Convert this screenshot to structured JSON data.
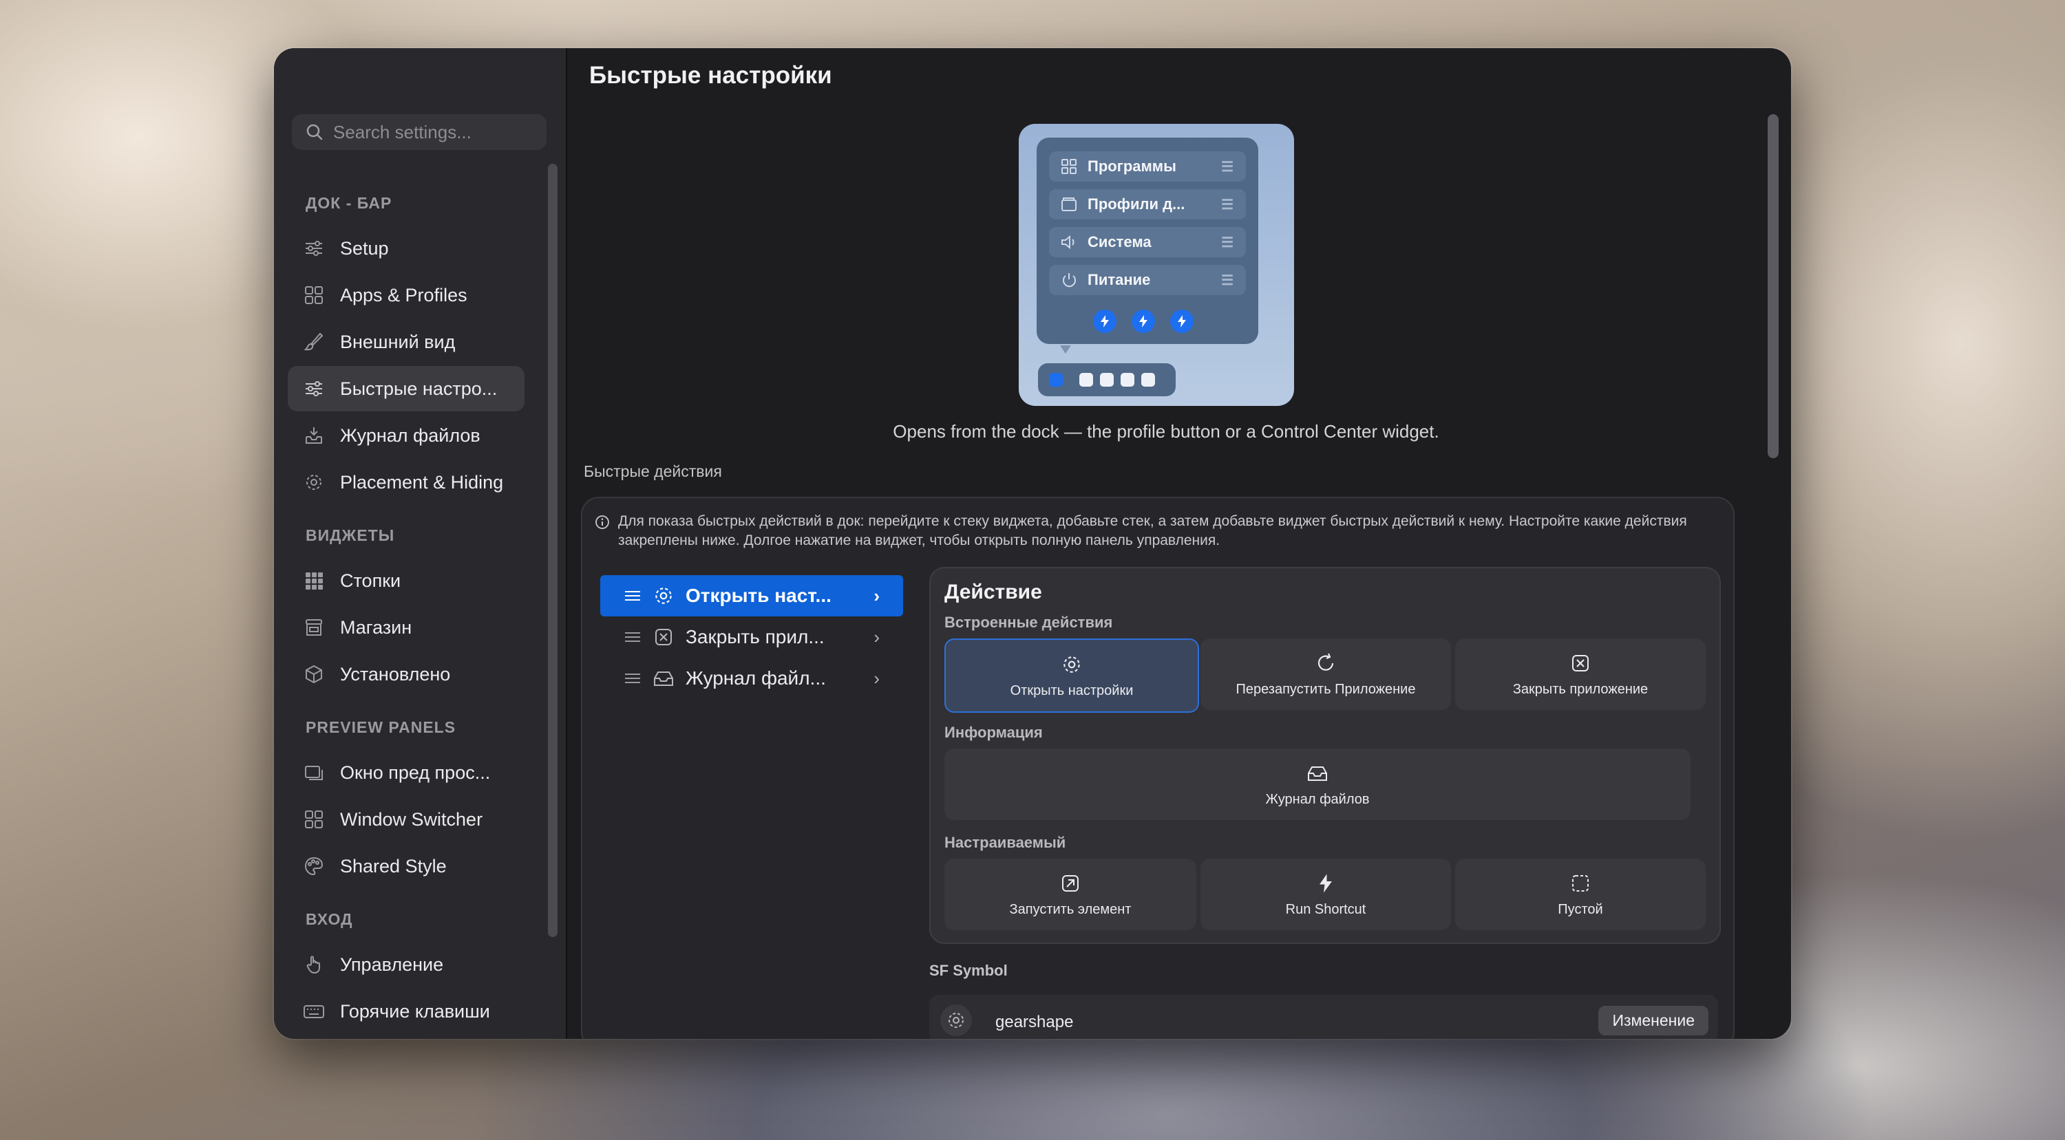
{
  "window": {
    "title": "Быстрые настройки"
  },
  "search": {
    "placeholder": "Search settings..."
  },
  "sidebar": {
    "sections": [
      {
        "title": "ДОК - БАР",
        "items": [
          {
            "label": "Setup",
            "icon": "sliders-icon"
          },
          {
            "label": "Apps & Profiles",
            "icon": "grid-icon"
          },
          {
            "label": "Внешний вид",
            "icon": "paintbrush-icon"
          },
          {
            "label": "Быстрые настро...",
            "icon": "sliders-icon",
            "active": true
          },
          {
            "label": "Журнал файлов",
            "icon": "tray-download-icon"
          },
          {
            "label": "Placement & Hiding",
            "icon": "gear-icon"
          }
        ]
      },
      {
        "title": "ВИДЖЕТЫ",
        "items": [
          {
            "label": "Стопки",
            "icon": "grid-filled-icon"
          },
          {
            "label": "Магазин",
            "icon": "storefront-icon"
          },
          {
            "label": "Установлено",
            "icon": "cube-icon"
          }
        ]
      },
      {
        "title": "PREVIEW PANELS",
        "items": [
          {
            "label": "Окно пред прос...",
            "icon": "windows-icon"
          },
          {
            "label": "Window Switcher",
            "icon": "grid-icon"
          },
          {
            "label": "Shared Style",
            "icon": "palette-icon"
          }
        ]
      },
      {
        "title": "ВХОД",
        "items": [
          {
            "label": "Управление",
            "icon": "hand-pointer-icon"
          },
          {
            "label": "Горячие клавиши",
            "icon": "keyboard-icon"
          }
        ]
      }
    ]
  },
  "preview": {
    "rows": [
      {
        "label": "Программы",
        "icon": "grid-icon"
      },
      {
        "label": "Профили д...",
        "icon": "folder-icon"
      },
      {
        "label": "Система",
        "icon": "speaker-icon"
      },
      {
        "label": "Питание",
        "icon": "power-icon"
      }
    ],
    "caption": "Opens from the dock — the profile button or a Control Center widget."
  },
  "quick_actions": {
    "section_label": "Быстрые действия",
    "info": "Для показа быстрых действий в док: перейдите к стеку виджета, добавьте стек, а затем добавьте виджет быстрых действий к нему. Настройте какие действия закреплены ниже. Долгое нажатие на виджет, чтобы открыть полную панель управления.",
    "list": [
      {
        "label": "Открыть наст...",
        "icon": "gear-icon",
        "selected": true
      },
      {
        "label": "Закрыть прил...",
        "icon": "xmark-square-icon"
      },
      {
        "label": "Журнал файл...",
        "icon": "tray-icon"
      }
    ]
  },
  "action": {
    "title": "Действие",
    "groups": [
      {
        "title": "Встроенные действия",
        "buttons": [
          {
            "label": "Открыть настройки",
            "icon": "gear-icon",
            "selected": true
          },
          {
            "label": "Перезапустить Приложение",
            "icon": "restart-icon"
          },
          {
            "label": "Закрыть приложение",
            "icon": "xmark-square-icon"
          }
        ]
      },
      {
        "title": "Информация",
        "buttons": [
          {
            "label": "Журнал файлов",
            "icon": "tray-icon"
          }
        ]
      },
      {
        "title": "Настраиваемый",
        "buttons": [
          {
            "label": "Запустить элемент",
            "icon": "arrow-up-right-square-icon"
          },
          {
            "label": "Run Shortcut",
            "icon": "bolt-icon"
          },
          {
            "label": "Пустой",
            "icon": "dashed-square-icon"
          }
        ]
      }
    ]
  },
  "sf_symbol": {
    "label": "SF Symbol",
    "name": "gearshape",
    "change_label": "Изменение"
  },
  "colors": {
    "accent": "#0f62d8",
    "close": "#fe5f57",
    "window_bg": "#1d1d20",
    "sidebar_bg": "#29292d"
  }
}
